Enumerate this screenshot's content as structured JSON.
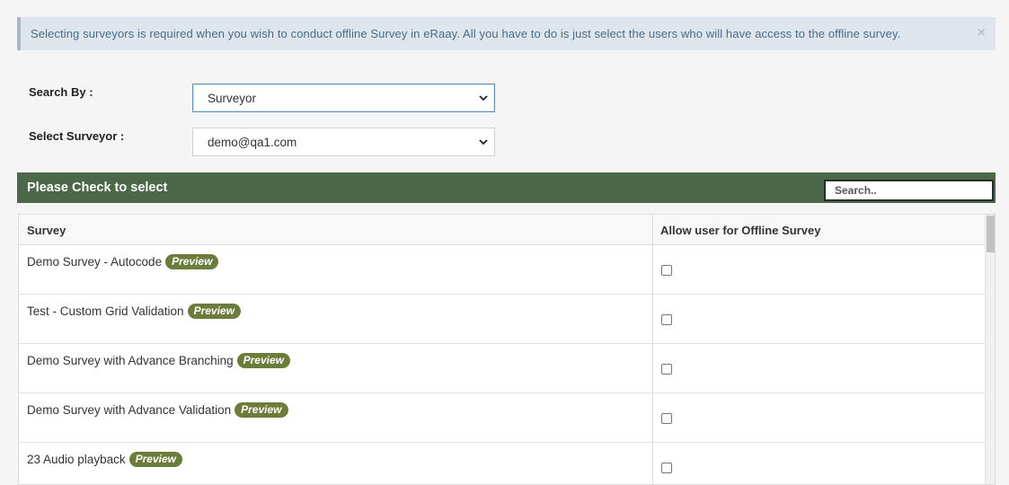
{
  "alert": {
    "message": "Selecting surveyors is required when you wish to conduct offline Survey in eRaay. All you have to do is just select the users who will have access to the offline survey.",
    "close_glyph": "×"
  },
  "form": {
    "search_by_label": "Search By :",
    "search_by_value": "Surveyor",
    "select_surveyor_label": "Select Surveyor :",
    "select_surveyor_value": "demo@qa1.com"
  },
  "panel": {
    "title": "Please Check to select",
    "search_placeholder": "Search.."
  },
  "table": {
    "headers": [
      "Survey",
      "Allow user for Offline Survey"
    ],
    "preview_label": "Preview",
    "rows": [
      {
        "name": "Demo Survey - Autocode",
        "checked": false
      },
      {
        "name": "Test - Custom Grid Validation",
        "checked": false
      },
      {
        "name": "Demo Survey with Advance Branching",
        "checked": false
      },
      {
        "name": "Demo Survey with Advance Validation",
        "checked": false
      },
      {
        "name": "23 Audio playback",
        "checked": false
      }
    ]
  },
  "colors": {
    "panel_header": "#4b6848",
    "preview_badge": "#6b7d3a",
    "alert_bg": "#dfe5ec",
    "alert_text": "#4a6b8a"
  }
}
